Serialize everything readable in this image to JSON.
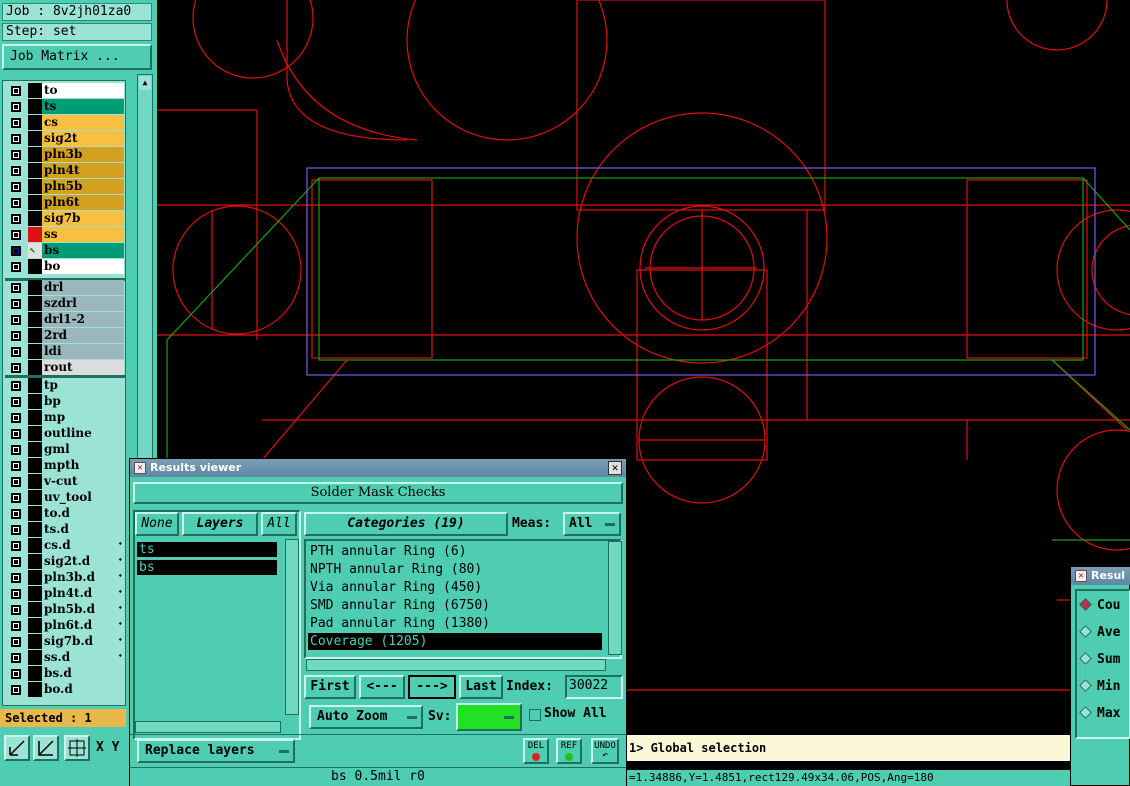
{
  "job": {
    "label": "Job : 8v2jh01za0",
    "step": "Step: set",
    "matrix_button": "Job Matrix ..."
  },
  "layers_board": [
    {
      "name": "to",
      "bg": "#ffffff"
    },
    {
      "name": "ts",
      "bg": "#009b77"
    },
    {
      "name": "cs",
      "bg": "#f7c040"
    },
    {
      "name": "sig2t",
      "bg": "#f7c040"
    },
    {
      "name": "pln3b",
      "bg": "#d4a020"
    },
    {
      "name": "pln4t",
      "bg": "#d4a020"
    },
    {
      "name": "pln5b",
      "bg": "#d4a020"
    },
    {
      "name": "pln6t",
      "bg": "#d4a020"
    },
    {
      "name": "sig7b",
      "bg": "#f7c040"
    },
    {
      "name": "ss",
      "bg": "#f7c040"
    },
    {
      "name": "bs",
      "bg": "#009b77"
    },
    {
      "name": "bo",
      "bg": "#ffffff"
    }
  ],
  "layers_drill": [
    {
      "name": "drl"
    },
    {
      "name": "szdrl"
    },
    {
      "name": "drl1-2"
    },
    {
      "name": "2rd"
    },
    {
      "name": "ldi"
    },
    {
      "name": "rout"
    }
  ],
  "layers_misc": [
    {
      "name": "tp"
    },
    {
      "name": "bp"
    },
    {
      "name": "mp"
    },
    {
      "name": "outline"
    },
    {
      "name": "gml"
    },
    {
      "name": "mpth"
    },
    {
      "name": "v-cut"
    },
    {
      "name": "uv_tool"
    },
    {
      "name": "to.d"
    },
    {
      "name": "ts.d"
    },
    {
      "name": "cs.d"
    },
    {
      "name": "sig2t.d"
    },
    {
      "name": "pln3b.d"
    },
    {
      "name": "pln4t.d"
    },
    {
      "name": "pln5b.d"
    },
    {
      "name": "pln6t.d"
    },
    {
      "name": "sig7b.d"
    },
    {
      "name": "ss.d"
    },
    {
      "name": "bs.d"
    },
    {
      "name": "bo.d"
    }
  ],
  "selected": "Selected : 1",
  "toolbar": {
    "xy": "X Y"
  },
  "results_viewer": {
    "title": "Results viewer",
    "check_name": "Solder Mask Checks",
    "none_btn": "None",
    "layers_btn": "Layers",
    "all_btn": "All",
    "layer_list": [
      "ts",
      "bs"
    ],
    "categories_btn": "Categories (19)",
    "meas_label": "Meas:",
    "meas_value": "All",
    "categories": [
      "PTH annular Ring (6)",
      "NPTH annular Ring (80)",
      "Via annular Ring (450)",
      "SMD annular Ring (6750)",
      "Pad annular Ring (1380)",
      "Coverage (1205)"
    ],
    "first": "First",
    "prev": "<---",
    "next": "--->",
    "last": "Last",
    "index_label": "Index:",
    "index_value": "30022",
    "auto_zoom": "Auto Zoom",
    "sv_label": "Sv:",
    "show_all": "Show All",
    "replace_layers": "Replace layers",
    "del": "DEL",
    "ref": "REF",
    "undo": "UNDO",
    "footer": "bs 0.5mil  r0"
  },
  "command_line": "1> Global selection",
  "status_line": "=1.34886,Y=1.4851,rect129.49x34.06,POS,Ang=180",
  "results2": {
    "title": "Resul",
    "options": [
      "Cou",
      "Ave",
      "Sum",
      "Min",
      "Max"
    ]
  }
}
